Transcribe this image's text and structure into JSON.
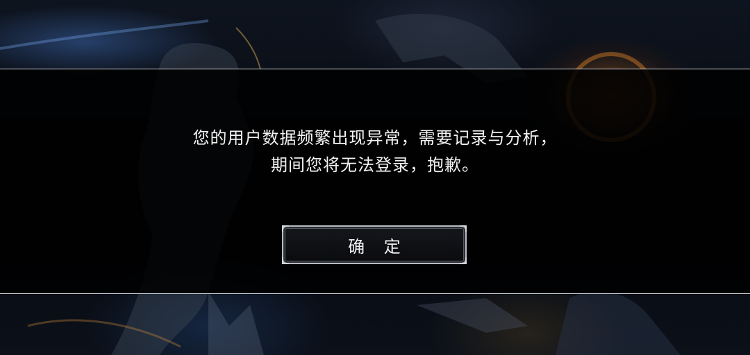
{
  "dialog": {
    "message_lines": [
      "您的用户数据频繁出现异常，需要记录与分析，",
      "期间您将无法登录，抱歉。"
    ],
    "confirm_label": "确 定"
  },
  "colors": {
    "band": "#000000",
    "band_border": "#cfd3da",
    "text": "#f2f2f2",
    "button_border": "#b9bcc2",
    "glow_orange": "#be6e1e",
    "glow_blue": "#4678c8"
  }
}
